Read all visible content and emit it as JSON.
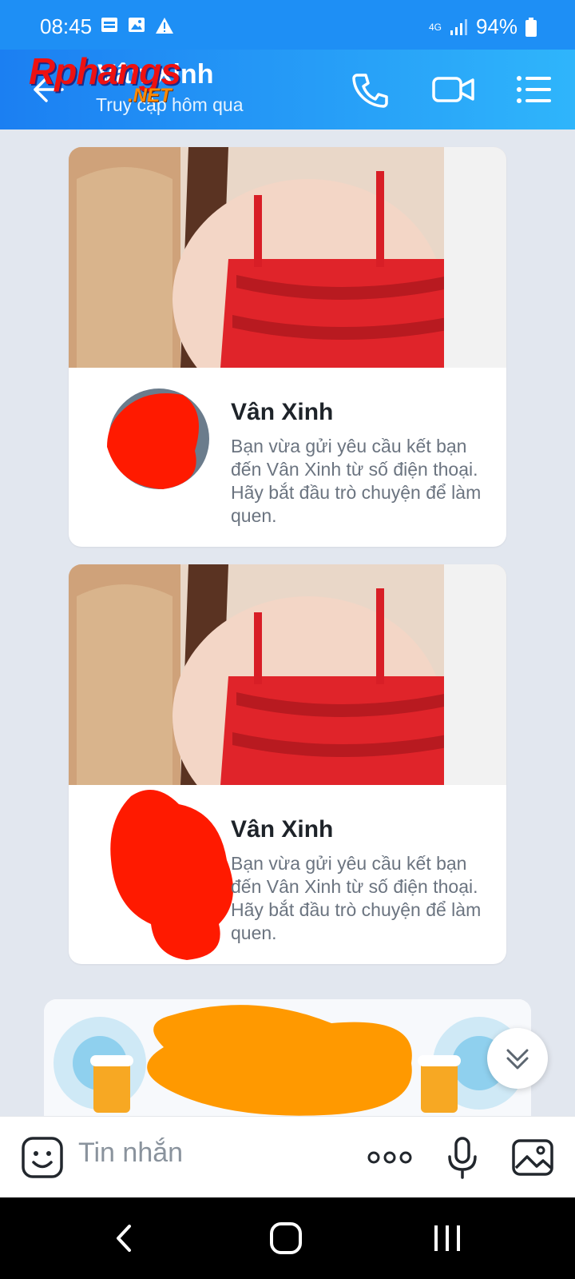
{
  "status_bar": {
    "time": "08:45",
    "network": "4G",
    "battery": "94%"
  },
  "header": {
    "contact_name": "Vân Xinh",
    "last_seen": "Truy cập hôm qua",
    "watermark_main": "Rphangs",
    "watermark_sub": ".NET"
  },
  "cards": [
    {
      "name": "Vân Xinh",
      "text": "Bạn vừa gửi yêu cầu kết bạn đến Vân Xinh từ số điện thoại. Hãy bắt đầu trò chuyện để làm quen."
    },
    {
      "name": "Vân Xinh",
      "text": "Bạn vừa gửi yêu cầu kết bạn đến Vân Xinh từ số điện thoại. Hãy bắt đầu trò chuyện để làm quen."
    }
  ],
  "input": {
    "placeholder": "Tin nhắn"
  },
  "icons": {
    "back": "arrow-left-icon",
    "call": "phone-icon",
    "video": "video-camera-icon",
    "menu": "list-menu-icon",
    "sticker": "smiley-icon",
    "more": "more-dots-icon",
    "voice": "microphone-icon",
    "gallery": "image-icon",
    "scroll_down": "double-chevron-down-icon"
  },
  "colors": {
    "header_start": "#1b7ff2",
    "header_end": "#2fb5fb",
    "background": "#e2e7ef",
    "censor_red": "#ff1a00",
    "censor_orange": "#ff9900"
  }
}
